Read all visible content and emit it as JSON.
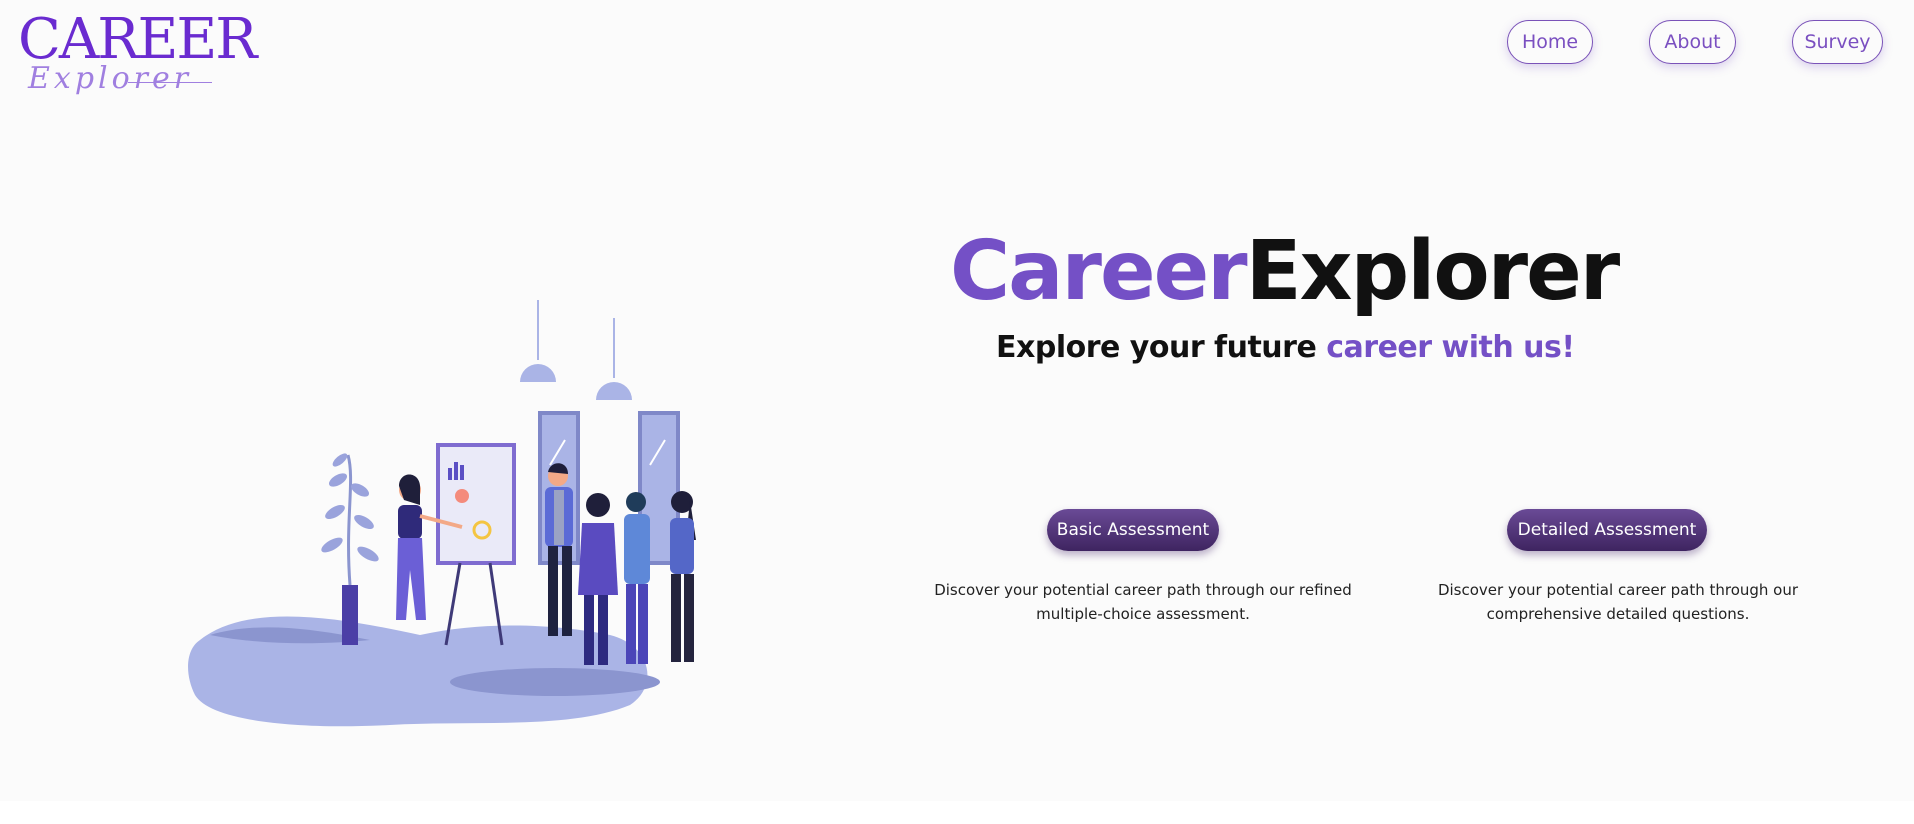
{
  "logo": {
    "main": "CAREER",
    "script": "Explorer"
  },
  "nav": {
    "home": "Home",
    "about": "About",
    "survey": "Survey"
  },
  "hero": {
    "title_part1": "Career",
    "title_part2": "Explorer",
    "subtitle_part1": "Explore your future ",
    "subtitle_part2": "career with us!"
  },
  "assessments": {
    "basic": {
      "label": "Basic Assessment",
      "description": "Discover your potential career path through our refined multiple-choice assessment."
    },
    "detailed": {
      "label": "Detailed Assessment",
      "description": "Discover your potential career path through our comprehensive detailed questions."
    }
  },
  "colors": {
    "accent": "#7450c6",
    "button_dark": "#3e2460",
    "illustration_light": "#aab4e6",
    "illustration_dark": "#5b4fc4"
  },
  "icons": {
    "illustration": "team-presentation-illustration"
  }
}
